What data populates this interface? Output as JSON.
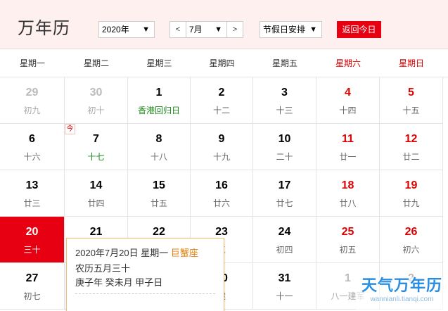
{
  "header": {
    "title": "万年历",
    "year_value": "2020年",
    "month_value": "7月",
    "prev_label": "<",
    "next_label": ">",
    "holiday_value": "节假日安排",
    "today_button": "返回今日",
    "dropdown_glyph": "▼"
  },
  "weekdays": [
    "星期一",
    "星期二",
    "星期三",
    "星期四",
    "星期五",
    "星期六",
    "星期日"
  ],
  "today_badge": "今",
  "weeks": [
    [
      {
        "day": "29",
        "lunar": "初九",
        "other": true
      },
      {
        "day": "30",
        "lunar": "初十",
        "other": true
      },
      {
        "day": "1",
        "lunar": "香港回归日",
        "festival": true
      },
      {
        "day": "2",
        "lunar": "十二"
      },
      {
        "day": "3",
        "lunar": "十三"
      },
      {
        "day": "4",
        "lunar": "十四",
        "weekend": true
      },
      {
        "day": "5",
        "lunar": "十五",
        "weekend": true
      }
    ],
    [
      {
        "day": "6",
        "lunar": "十六"
      },
      {
        "day": "7",
        "lunar": "十七",
        "term": true
      },
      {
        "day": "8",
        "lunar": "十八"
      },
      {
        "day": "9",
        "lunar": "十九"
      },
      {
        "day": "10",
        "lunar": "二十"
      },
      {
        "day": "11",
        "lunar": "廿一",
        "weekend": true
      },
      {
        "day": "12",
        "lunar": "廿二",
        "weekend": true
      }
    ],
    [
      {
        "day": "13",
        "lunar": "廿三"
      },
      {
        "day": "14",
        "lunar": "廿四"
      },
      {
        "day": "15",
        "lunar": "廿五"
      },
      {
        "day": "16",
        "lunar": "廿六"
      },
      {
        "day": "17",
        "lunar": "廿七"
      },
      {
        "day": "18",
        "lunar": "廿八",
        "weekend": true
      },
      {
        "day": "19",
        "lunar": "廿九",
        "weekend": true
      }
    ],
    [
      {
        "day": "20",
        "lunar": "三十",
        "selected": true
      },
      {
        "day": "21",
        "lunar": ""
      },
      {
        "day": "22",
        "lunar": ""
      },
      {
        "day": "23",
        "lunar": "三"
      },
      {
        "day": "24",
        "lunar": "初四"
      },
      {
        "day": "25",
        "lunar": "初五",
        "weekend": true
      },
      {
        "day": "26",
        "lunar": "初六",
        "weekend": true
      }
    ],
    [
      {
        "day": "27",
        "lunar": "初七"
      },
      {
        "day": "",
        "lunar": ""
      },
      {
        "day": "",
        "lunar": ""
      },
      {
        "day": "30",
        "lunar": "建"
      },
      {
        "day": "31",
        "lunar": "十一"
      },
      {
        "day": "1",
        "lunar": "八一建军",
        "other": true
      },
      {
        "day": "2",
        "lunar": "",
        "other": true
      }
    ]
  ],
  "popup": {
    "date_line": "2020年7月20日 星期一",
    "zodiac": "巨蟹座",
    "lunar_line": "农历五月三十",
    "ganzhi_line": "庚子年 癸未月 甲子日"
  },
  "watermark": {
    "main": "天气万年历",
    "sub": "wannianli.tianqi.com"
  },
  "colors": {
    "accent": "#e60012",
    "weekend": "#dd0000",
    "festival": "#1a8a1a",
    "zodiac": "#e6820b",
    "watermark": "#2a8ee0"
  }
}
